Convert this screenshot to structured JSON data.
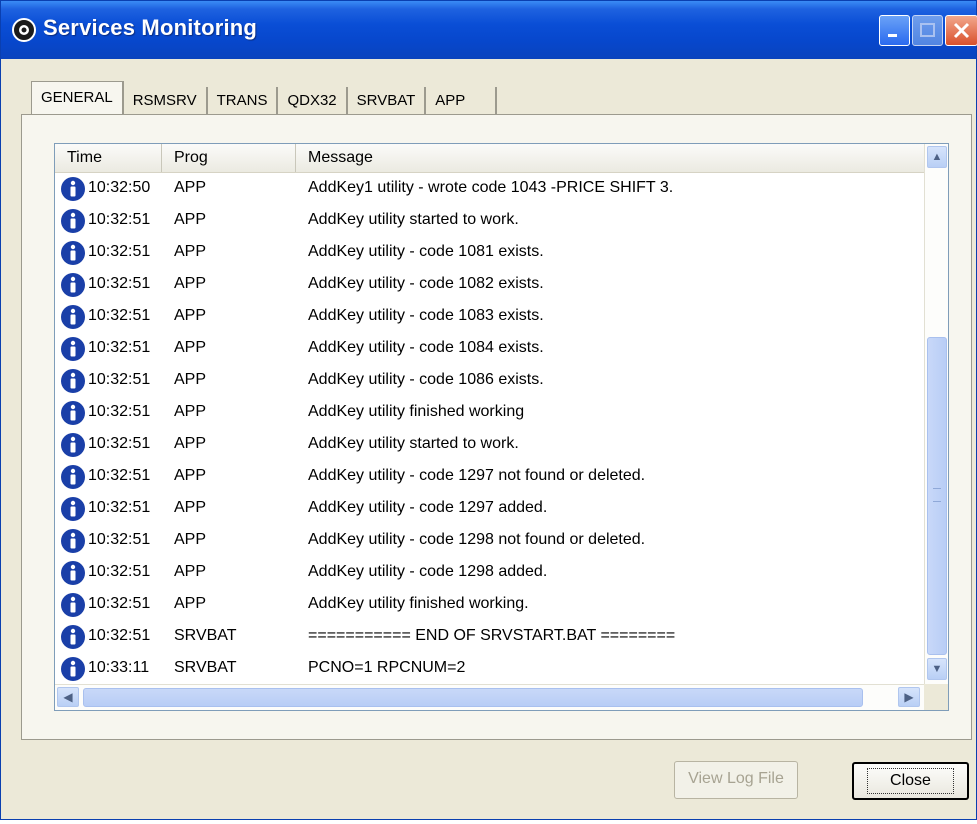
{
  "window": {
    "title": "Services Monitoring",
    "icon": "services-app-icon"
  },
  "tabs": [
    {
      "label": "GENERAL",
      "active": true
    },
    {
      "label": "RSMSRV",
      "active": false
    },
    {
      "label": "TRANS",
      "active": false
    },
    {
      "label": "QDX32",
      "active": false
    },
    {
      "label": "SRVBAT",
      "active": false
    },
    {
      "label": "APP",
      "active": false
    }
  ],
  "log": {
    "columns": [
      "Time",
      "Prog",
      "Message"
    ],
    "rows": [
      {
        "time": "10:32:50",
        "prog": "APP",
        "message": "AddKey1 utility - wrote code 1043 -PRICE SHIFT 3."
      },
      {
        "time": "10:32:51",
        "prog": "APP",
        "message": "AddKey utility started to work."
      },
      {
        "time": "10:32:51",
        "prog": "APP",
        "message": "AddKey utility - code 1081 exists."
      },
      {
        "time": "10:32:51",
        "prog": "APP",
        "message": "AddKey utility - code 1082 exists."
      },
      {
        "time": "10:32:51",
        "prog": "APP",
        "message": "AddKey utility - code 1083 exists."
      },
      {
        "time": "10:32:51",
        "prog": "APP",
        "message": "AddKey utility - code 1084 exists."
      },
      {
        "time": "10:32:51",
        "prog": "APP",
        "message": "AddKey utility - code 1086 exists."
      },
      {
        "time": "10:32:51",
        "prog": "APP",
        "message": "AddKey utility finished working"
      },
      {
        "time": "10:32:51",
        "prog": "APP",
        "message": "AddKey utility started to work."
      },
      {
        "time": "10:32:51",
        "prog": "APP",
        "message": "AddKey utility - code 1297 not found or deleted."
      },
      {
        "time": "10:32:51",
        "prog": "APP",
        "message": "AddKey utility - code 1297 added."
      },
      {
        "time": "10:32:51",
        "prog": "APP",
        "message": "AddKey utility - code 1298 not found or deleted."
      },
      {
        "time": "10:32:51",
        "prog": "APP",
        "message": "AddKey utility - code 1298 added."
      },
      {
        "time": "10:32:51",
        "prog": "APP",
        "message": "AddKey utility finished working."
      },
      {
        "time": "10:32:51",
        "prog": "SRVBAT",
        "message": "=========== END OF SRVSTART.BAT ========"
      },
      {
        "time": "10:33:11",
        "prog": "SRVBAT",
        "message": "PCNO=1 RPCNUM=2"
      }
    ]
  },
  "buttons": {
    "view_log": "View Log File",
    "close": "Close"
  },
  "colors": {
    "titlebar": "#0a4ed6",
    "info_icon": "#1a3fa8",
    "face": "#ece9d8"
  }
}
